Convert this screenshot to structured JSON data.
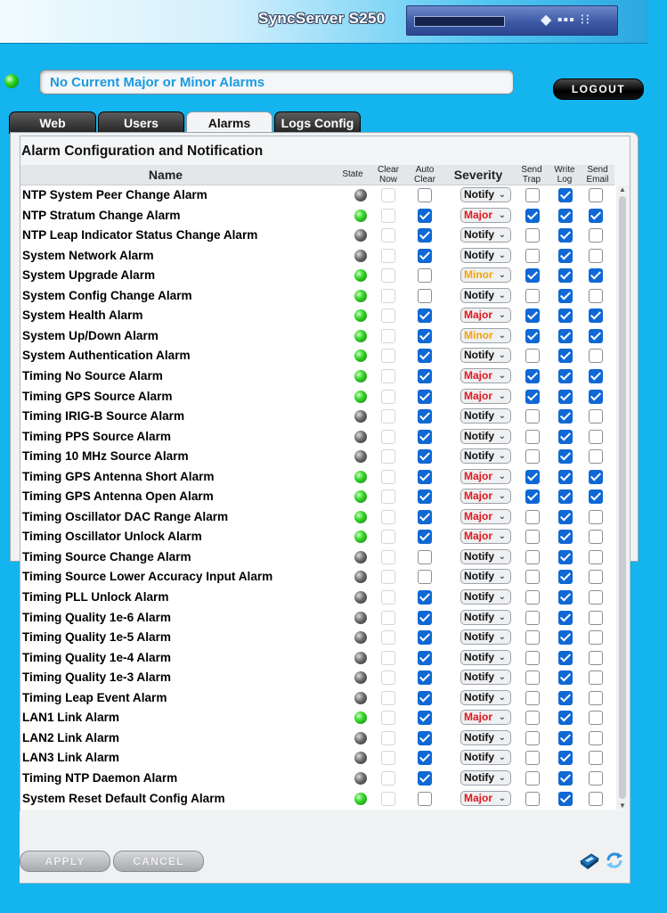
{
  "header": {
    "product": "SyncServer S250"
  },
  "status": {
    "message": "No Current Major or Minor Alarms",
    "indicator_color": "#2ad41e"
  },
  "logout_label": "LOGOUT",
  "tabs": [
    {
      "label": "Web",
      "active": false
    },
    {
      "label": "Users",
      "active": false
    },
    {
      "label": "Alarms",
      "active": true
    },
    {
      "label": "Logs Config",
      "active": false
    }
  ],
  "section_title": "Alarm Configuration and Notification",
  "columns": {
    "name": "Name",
    "state": "State",
    "clear_now": [
      "Clear",
      "Now"
    ],
    "auto_clear": [
      "Auto",
      "Clear"
    ],
    "severity": "Severity",
    "send_trap": [
      "Send",
      "Trap"
    ],
    "write_log": [
      "Write",
      "Log"
    ],
    "send_email": [
      "Send",
      "Email"
    ]
  },
  "severity_colors": {
    "Notify": "#111111",
    "Major": "#e0161c",
    "Minor": "#f2a20c"
  },
  "alarms": [
    {
      "name": "NTP System Peer Change Alarm",
      "state": "off",
      "auto_clear": false,
      "severity": "Notify",
      "send_trap": false,
      "write_log": true,
      "send_email": false
    },
    {
      "name": "NTP Stratum Change Alarm",
      "state": "on",
      "auto_clear": true,
      "severity": "Major",
      "send_trap": true,
      "write_log": true,
      "send_email": true
    },
    {
      "name": "NTP Leap Indicator Status Change Alarm",
      "state": "off",
      "auto_clear": true,
      "severity": "Notify",
      "send_trap": false,
      "write_log": true,
      "send_email": false
    },
    {
      "name": "System Network Alarm",
      "state": "off",
      "auto_clear": true,
      "severity": "Notify",
      "send_trap": false,
      "write_log": true,
      "send_email": false
    },
    {
      "name": "System Upgrade Alarm",
      "state": "on",
      "auto_clear": false,
      "severity": "Minor",
      "send_trap": true,
      "write_log": true,
      "send_email": true
    },
    {
      "name": "System Config Change Alarm",
      "state": "on",
      "auto_clear": false,
      "severity": "Notify",
      "send_trap": false,
      "write_log": true,
      "send_email": false
    },
    {
      "name": "System  Health Alarm",
      "state": "on",
      "auto_clear": true,
      "severity": "Major",
      "send_trap": true,
      "write_log": true,
      "send_email": true
    },
    {
      "name": "System Up/Down Alarm",
      "state": "on",
      "auto_clear": true,
      "severity": "Minor",
      "send_trap": true,
      "write_log": true,
      "send_email": true
    },
    {
      "name": "System Authentication Alarm",
      "state": "on",
      "auto_clear": true,
      "severity": "Notify",
      "send_trap": false,
      "write_log": true,
      "send_email": false
    },
    {
      "name": "Timing No Source Alarm",
      "state": "on",
      "auto_clear": true,
      "severity": "Major",
      "send_trap": true,
      "write_log": true,
      "send_email": true
    },
    {
      "name": "Timing GPS Source Alarm",
      "state": "on",
      "auto_clear": true,
      "severity": "Major",
      "send_trap": true,
      "write_log": true,
      "send_email": true
    },
    {
      "name": "Timing IRIG-B Source Alarm",
      "state": "off",
      "auto_clear": true,
      "severity": "Notify",
      "send_trap": false,
      "write_log": true,
      "send_email": false
    },
    {
      "name": "Timing PPS Source Alarm",
      "state": "off",
      "auto_clear": true,
      "severity": "Notify",
      "send_trap": false,
      "write_log": true,
      "send_email": false
    },
    {
      "name": "Timing 10 MHz Source Alarm",
      "state": "off",
      "auto_clear": true,
      "severity": "Notify",
      "send_trap": false,
      "write_log": true,
      "send_email": false
    },
    {
      "name": "Timing GPS Antenna Short Alarm",
      "state": "on",
      "auto_clear": true,
      "severity": "Major",
      "send_trap": true,
      "write_log": true,
      "send_email": true
    },
    {
      "name": "Timing GPS Antenna Open Alarm",
      "state": "on",
      "auto_clear": true,
      "severity": "Major",
      "send_trap": true,
      "write_log": true,
      "send_email": true
    },
    {
      "name": "Timing Oscillator DAC Range Alarm",
      "state": "on",
      "auto_clear": true,
      "severity": "Major",
      "send_trap": false,
      "write_log": true,
      "send_email": false
    },
    {
      "name": "Timing Oscillator Unlock Alarm",
      "state": "on",
      "auto_clear": true,
      "severity": "Major",
      "send_trap": false,
      "write_log": true,
      "send_email": false
    },
    {
      "name": "Timing Source Change Alarm",
      "state": "off",
      "auto_clear": false,
      "severity": "Notify",
      "send_trap": false,
      "write_log": true,
      "send_email": false
    },
    {
      "name": "Timing Source Lower Accuracy Input Alarm",
      "state": "off",
      "auto_clear": false,
      "severity": "Notify",
      "send_trap": false,
      "write_log": true,
      "send_email": false
    },
    {
      "name": "Timing PLL Unlock Alarm",
      "state": "off",
      "auto_clear": true,
      "severity": "Notify",
      "send_trap": false,
      "write_log": true,
      "send_email": false
    },
    {
      "name": "Timing Quality 1e-6 Alarm",
      "state": "off",
      "auto_clear": true,
      "severity": "Notify",
      "send_trap": false,
      "write_log": true,
      "send_email": false
    },
    {
      "name": "Timing Quality 1e-5 Alarm",
      "state": "off",
      "auto_clear": true,
      "severity": "Notify",
      "send_trap": false,
      "write_log": true,
      "send_email": false
    },
    {
      "name": "Timing Quality 1e-4 Alarm",
      "state": "off",
      "auto_clear": true,
      "severity": "Notify",
      "send_trap": false,
      "write_log": true,
      "send_email": false
    },
    {
      "name": "Timing Quality 1e-3 Alarm",
      "state": "off",
      "auto_clear": true,
      "severity": "Notify",
      "send_trap": false,
      "write_log": true,
      "send_email": false
    },
    {
      "name": "Timing Leap Event Alarm",
      "state": "off",
      "auto_clear": true,
      "severity": "Notify",
      "send_trap": false,
      "write_log": true,
      "send_email": false
    },
    {
      "name": "LAN1 Link Alarm",
      "state": "on",
      "auto_clear": true,
      "severity": "Major",
      "send_trap": false,
      "write_log": true,
      "send_email": false
    },
    {
      "name": "LAN2 Link Alarm",
      "state": "off",
      "auto_clear": true,
      "severity": "Notify",
      "send_trap": false,
      "write_log": true,
      "send_email": false
    },
    {
      "name": "LAN3 Link Alarm",
      "state": "off",
      "auto_clear": true,
      "severity": "Notify",
      "send_trap": false,
      "write_log": true,
      "send_email": false
    },
    {
      "name": "Timing NTP Daemon Alarm",
      "state": "off",
      "auto_clear": true,
      "severity": "Notify",
      "send_trap": false,
      "write_log": true,
      "send_email": false
    },
    {
      "name": "System Reset Default Config Alarm",
      "state": "on",
      "auto_clear": false,
      "severity": "Major",
      "send_trap": false,
      "write_log": true,
      "send_email": false
    }
  ],
  "buttons": {
    "apply": "APPLY",
    "cancel": "CANCEL"
  },
  "icons": {
    "help": "help-book-icon",
    "refresh": "refresh-icon"
  }
}
